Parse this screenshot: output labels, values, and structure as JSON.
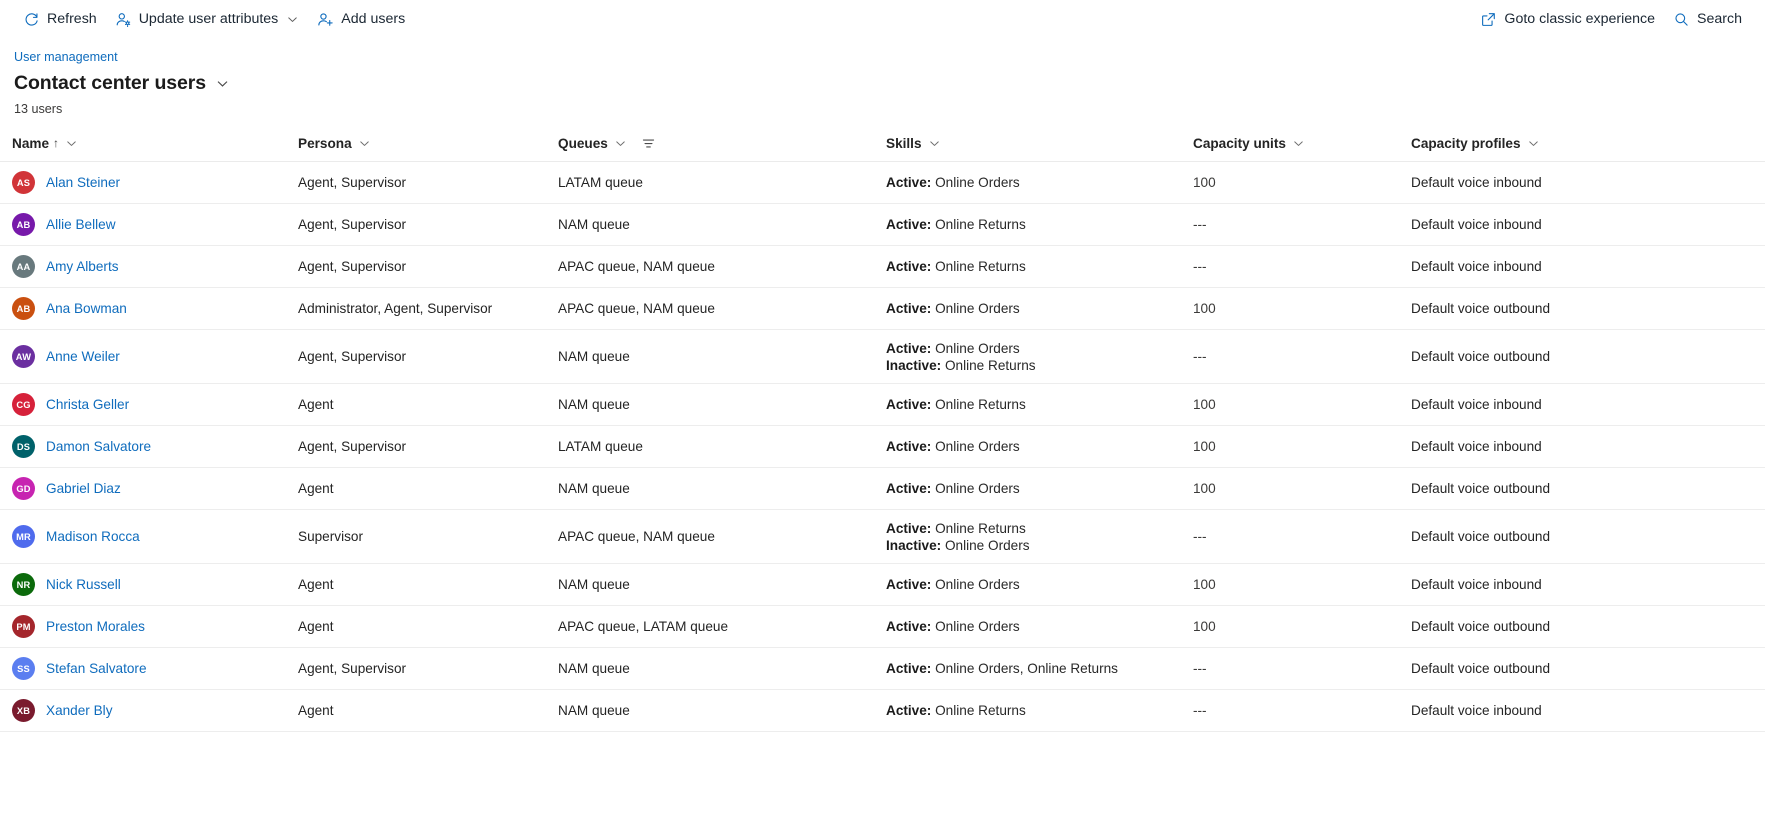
{
  "toolbar": {
    "left": [
      {
        "icon": "refresh-icon",
        "label": "Refresh",
        "has_chevron": false
      },
      {
        "icon": "user-settings-icon",
        "label": "Update user attributes",
        "has_chevron": true
      },
      {
        "icon": "add-user-icon",
        "label": "Add users",
        "has_chevron": false
      }
    ],
    "right": [
      {
        "icon": "open-external-icon",
        "label": "Goto classic experience"
      },
      {
        "icon": "search-icon",
        "label": "Search"
      }
    ]
  },
  "header": {
    "breadcrumb": "User management",
    "title": "Contact center users",
    "title_chevron_icon": "chevron-down-icon",
    "count_label": "13 users"
  },
  "table": {
    "columns": [
      {
        "key": "name",
        "label": "Name",
        "sorted": true,
        "sort_glyph": "↑",
        "chevron": true,
        "filter": false
      },
      {
        "key": "persona",
        "label": "Persona",
        "sorted": false,
        "sort_glyph": "",
        "chevron": true,
        "filter": false
      },
      {
        "key": "queues",
        "label": "Queues",
        "sorted": false,
        "sort_glyph": "",
        "chevron": true,
        "filter": true
      },
      {
        "key": "skills",
        "label": "Skills",
        "sorted": false,
        "sort_glyph": "",
        "chevron": true,
        "filter": false
      },
      {
        "key": "units",
        "label": "Capacity units",
        "sorted": false,
        "sort_glyph": "",
        "chevron": true,
        "filter": false
      },
      {
        "key": "profiles",
        "label": "Capacity profiles",
        "sorted": false,
        "sort_glyph": "",
        "chevron": true,
        "filter": false
      }
    ],
    "rows": [
      {
        "initials": "AS",
        "avatar_color": "#d13438",
        "name": "Alan Steiner",
        "persona": "Agent, Supervisor",
        "queues": "LATAM queue",
        "skills": [
          {
            "state": "Active:",
            "value": "Online Orders"
          }
        ],
        "units": "100",
        "profiles": "Default voice inbound"
      },
      {
        "initials": "AB",
        "avatar_color": "#7719aa",
        "name": "Allie Bellew",
        "persona": "Agent, Supervisor",
        "queues": "NAM queue",
        "skills": [
          {
            "state": "Active:",
            "value": "Online Returns"
          }
        ],
        "units": "---",
        "profiles": "Default voice inbound"
      },
      {
        "initials": "AA",
        "avatar_color": "#68797d",
        "name": "Amy Alberts",
        "persona": "Agent, Supervisor",
        "queues": "APAC queue, NAM queue",
        "skills": [
          {
            "state": "Active:",
            "value": "Online Returns"
          }
        ],
        "units": "---",
        "profiles": "Default voice inbound"
      },
      {
        "initials": "AB",
        "avatar_color": "#ca5010",
        "name": "Ana Bowman",
        "persona": "Administrator, Agent, Supervisor",
        "queues": "APAC queue, NAM queue",
        "skills": [
          {
            "state": "Active:",
            "value": "Online Orders"
          }
        ],
        "units": "100",
        "profiles": "Default voice outbound"
      },
      {
        "initials": "AW",
        "avatar_color": "#6b2fa0",
        "name": "Anne Weiler",
        "persona": "Agent, Supervisor",
        "queues": "NAM queue",
        "skills": [
          {
            "state": "Active:",
            "value": "Online Orders"
          },
          {
            "state": "Inactive:",
            "value": "Online Returns"
          }
        ],
        "units": "---",
        "profiles": "Default voice outbound"
      },
      {
        "initials": "CG",
        "avatar_color": "#d6213a",
        "name": "Christa Geller",
        "persona": "Agent",
        "queues": "NAM queue",
        "skills": [
          {
            "state": "Active:",
            "value": "Online Returns"
          }
        ],
        "units": "100",
        "profiles": "Default voice inbound"
      },
      {
        "initials": "DS",
        "avatar_color": "#00616a",
        "name": "Damon Salvatore",
        "persona": "Agent, Supervisor",
        "queues": "LATAM queue",
        "skills": [
          {
            "state": "Active:",
            "value": "Online Orders"
          }
        ],
        "units": "100",
        "profiles": "Default voice inbound"
      },
      {
        "initials": "GD",
        "avatar_color": "#c724b1",
        "name": "Gabriel Diaz",
        "persona": "Agent",
        "queues": "NAM queue",
        "skills": [
          {
            "state": "Active:",
            "value": "Online Orders"
          }
        ],
        "units": "100",
        "profiles": "Default voice outbound"
      },
      {
        "initials": "MR",
        "avatar_color": "#4f6bed",
        "name": "Madison Rocca",
        "persona": "Supervisor",
        "queues": "APAC queue, NAM queue",
        "skills": [
          {
            "state": "Active:",
            "value": "Online Returns"
          },
          {
            "state": "Inactive:",
            "value": "Online Orders"
          }
        ],
        "units": "---",
        "profiles": "Default voice outbound"
      },
      {
        "initials": "NR",
        "avatar_color": "#0b6a0b",
        "name": "Nick Russell",
        "persona": "Agent",
        "queues": "NAM queue",
        "skills": [
          {
            "state": "Active:",
            "value": "Online Orders"
          }
        ],
        "units": "100",
        "profiles": "Default voice inbound"
      },
      {
        "initials": "PM",
        "avatar_color": "#a4262c",
        "name": "Preston Morales",
        "persona": "Agent",
        "queues": "APAC queue, LATAM queue",
        "skills": [
          {
            "state": "Active:",
            "value": "Online Orders"
          }
        ],
        "units": "100",
        "profiles": "Default voice outbound"
      },
      {
        "initials": "SS",
        "avatar_color": "#5b7ef0",
        "name": "Stefan Salvatore",
        "persona": "Agent, Supervisor",
        "queues": "NAM queue",
        "skills": [
          {
            "state": "Active:",
            "value": "Online Orders, Online Returns"
          }
        ],
        "units": "---",
        "profiles": "Default voice outbound"
      },
      {
        "initials": "XB",
        "avatar_color": "#7a1b2e",
        "name": "Xander Bly",
        "persona": "Agent",
        "queues": "NAM queue",
        "skills": [
          {
            "state": "Active:",
            "value": "Online Returns"
          }
        ],
        "units": "---",
        "profiles": "Default voice inbound"
      }
    ]
  }
}
